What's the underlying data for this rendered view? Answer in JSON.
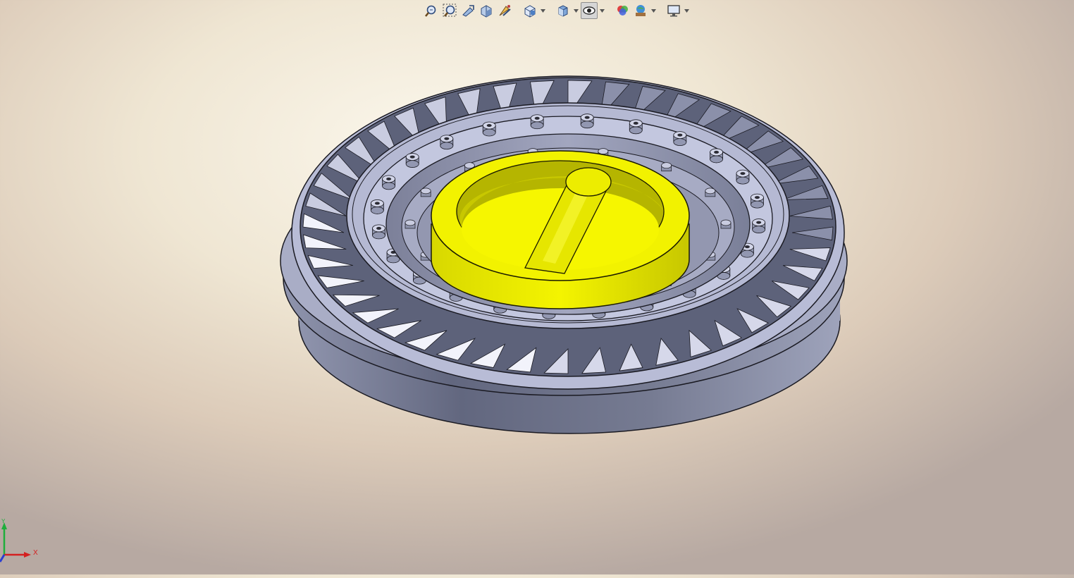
{
  "toolbar": {
    "buttons": [
      {
        "icon": "zoom-to-fit-icon"
      },
      {
        "icon": "zoom-to-area-icon"
      },
      {
        "icon": "previous-view-icon"
      },
      {
        "icon": "section-view-icon"
      },
      {
        "icon": "dynamic-annotation-views-icon"
      },
      {
        "icon": "view-orientation-icon",
        "dropdown": true
      },
      {
        "icon": "display-style-icon",
        "dropdown": true
      },
      {
        "icon": "hide-show-items-icon",
        "dropdown": true,
        "active": true
      },
      {
        "icon": "edit-appearance-icon"
      },
      {
        "icon": "apply-scene-icon",
        "dropdown": true
      },
      {
        "icon": "view-settings-icon",
        "dropdown": true
      }
    ]
  },
  "model": {
    "part_color": "#b9bdd6",
    "highlight_color": "#f2f200"
  },
  "triad": {
    "x_label": "X",
    "y_label": "Y",
    "x_color": "#d42020",
    "y_color": "#1fae3c",
    "z_color": "#2a3ed2"
  }
}
